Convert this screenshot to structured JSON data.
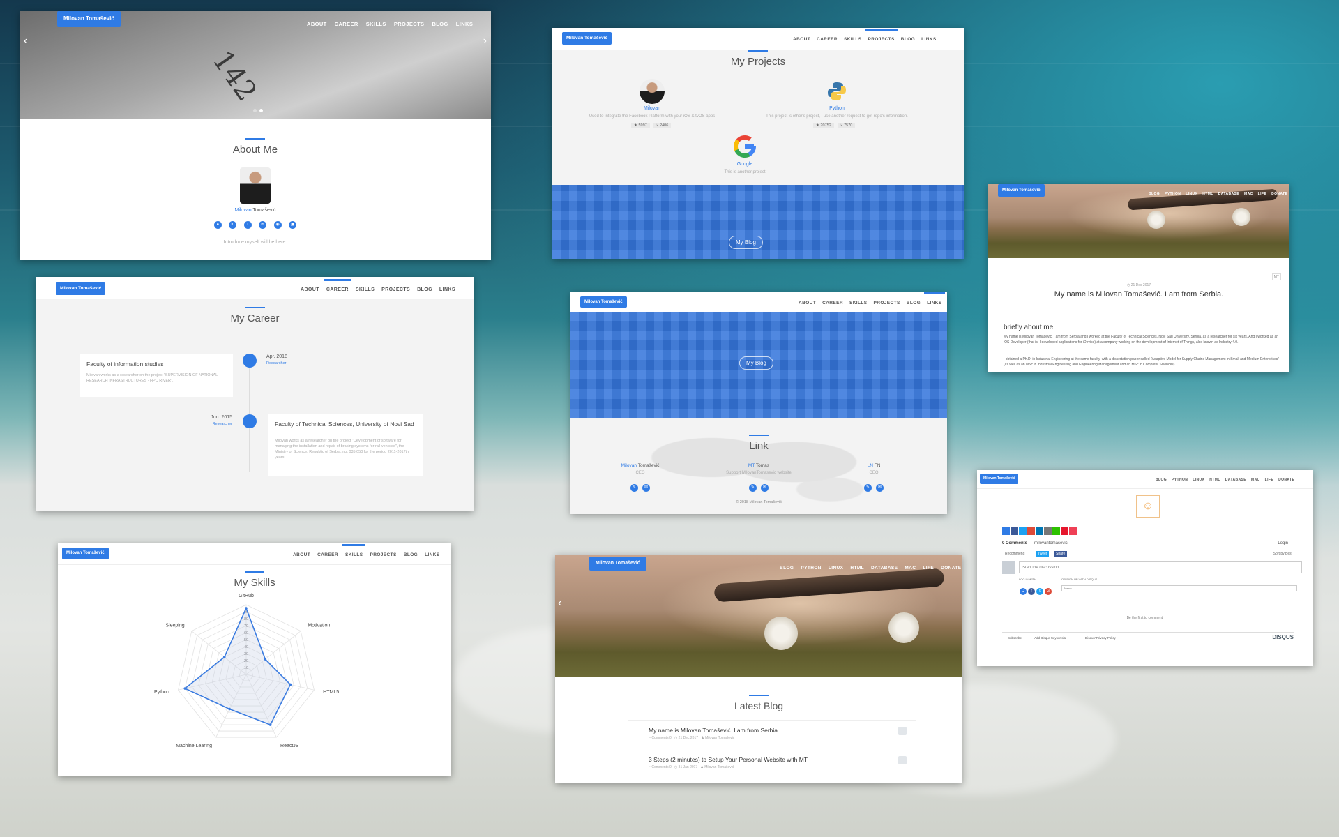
{
  "nav_main": [
    "ABOUT",
    "CAREER",
    "SKILLS",
    "PROJECTS",
    "BLOG",
    "LINKS"
  ],
  "nav_blog": [
    "BLOG",
    "PYTHON",
    "LINUX",
    "HTML",
    "DATABASE",
    "MAC",
    "LIFE",
    "DONATE"
  ],
  "brand": "Milovan Tomašević",
  "about": {
    "hero_text": "142",
    "title": "About Me",
    "first_name": "Milovan",
    "last_name": "Tomašević",
    "intro": "Introduce myself will be here."
  },
  "projects": {
    "title": "My Projects",
    "items": [
      {
        "name": "Milovan",
        "desc": "Used to integrate the Facebook Platform with your iOS & tvOS apps",
        "stars": "★ 5997",
        "forks": "⑂ 2406"
      },
      {
        "name": "Python",
        "desc": "This project is other's project, I use another request to get repo's information.",
        "stars": "★ 20752",
        "forks": "⑂ 7570"
      },
      {
        "name": "Google",
        "desc": "This is another project"
      }
    ],
    "blog_button": "My Blog"
  },
  "post_top": {
    "date": "◷ 21 Dec 2017",
    "badge": "MT",
    "title": "My name is Milovan Tomašević. I am from Serbia.",
    "heading": "briefly about me",
    "p1": "My name is Milovan Tomašević. I am from Serbia and I worked at the Faculty of Technical Sciences, Novi Sad University, Serbia, as a researcher for six years. And I worked as an iOS Developer (that is, I developed applications for iDevice) at a company working on the development of Internet of Things, also known as Industry 4.0.",
    "p2": "I obtained a Ph.D. in Industrial Engineering at the same faculty, with a dissertation paper called \"Adaptive Model for Supply Chains Management in Small and Medium Enterprises\" (as well as an MSc in Industrial Engineering and Engineering Management and an MSc in Computer Sciences)."
  },
  "career": {
    "title": "My Career",
    "items": [
      {
        "org": "Faculty of information studies",
        "desc": "Milovan works as a researcher on the project \"SUPERVISION OF NATIONAL RESEARCH INFRASTRUCTURES - HPC RIVER\".",
        "date": "Apr. 2018",
        "role": "Researcher"
      },
      {
        "org": "Faculty of Technical Sciences, University of Novi Sad",
        "desc": "Milovan works as a researcher on the project \"Development of software for managing the installation and repair of braking systems for rail vehicles\", the Ministry of Science, Republic of Serbia, no. 035 050 for the period 2011-2017th years.",
        "date": "Jun. 2015",
        "role": "Researcher"
      }
    ]
  },
  "links": {
    "blog_button": "My Blog",
    "title": "Link",
    "people": [
      {
        "first": "Milovan",
        "last": "Tomašević",
        "role": "CEO"
      },
      {
        "first": "MT",
        "last": "Tomas",
        "role": "Support MilovanTomasevic website"
      },
      {
        "first": "LN",
        "last": "FN",
        "role": "CEO"
      }
    ],
    "copyright": "© 2018 Milovan Tomašević"
  },
  "comments": {
    "count_label": "0 Comments",
    "site": "milovantomasevic",
    "login": "Login",
    "recommend": "Recommend",
    "tweet": "Tweet",
    "share": "Share",
    "sort": "Sort by Best",
    "placeholder": "Start the discussion...",
    "login_with": "LOG IN WITH",
    "signup_with": "OR SIGN UP WITH DISQUS",
    "name_placeholder": "Name",
    "empty": "Be the first to comment.",
    "subscribe": "Subscribe",
    "add_disqus": "Add Disqus to your site",
    "privacy": "Disqus' Privacy Policy",
    "logo": "DISQUS"
  },
  "skills": {
    "title": "My Skills"
  },
  "chart_data": {
    "type": "radar",
    "categories": [
      "GitHub",
      "Motivation",
      "HTML5",
      "ReactJS",
      "Machine Learing",
      "Python",
      "Sleeping"
    ],
    "values": [
      95,
      35,
      65,
      80,
      55,
      90,
      40
    ],
    "ticks": [
      10,
      20,
      30,
      40,
      50,
      60,
      70,
      80,
      90
    ],
    "range": [
      0,
      100
    ]
  },
  "latest_blog": {
    "title": "Latest Blog",
    "posts": [
      {
        "title": "My name is Milovan Tomašević. I am from Serbia.",
        "meta": "◔ Comments 0   ◷ 21 Dec 2017   ♟ Milovan Tomašević"
      },
      {
        "title": "3 Steps (2 minutes) to Setup Your Personal Website with MT",
        "meta": "◔ Comments 0   ◷ 31 Jan 2017   ♟ Milovan Tomašević"
      }
    ]
  },
  "colors": {
    "accent": "#2f7be5"
  }
}
